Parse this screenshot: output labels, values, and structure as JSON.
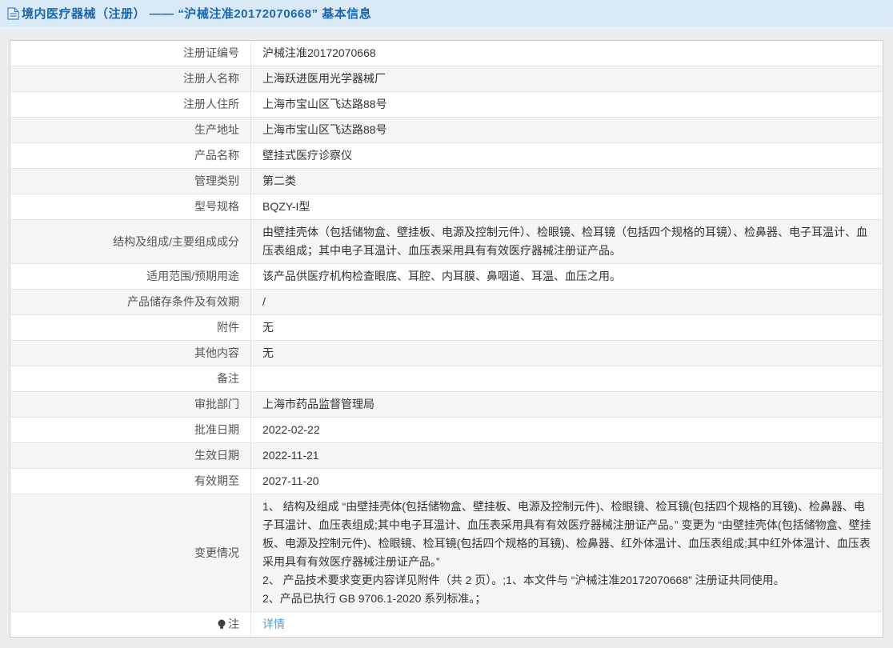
{
  "header": {
    "title": "境内医疗器械（注册） —— “沪械注准20172070668” 基本信息"
  },
  "table": {
    "rows": [
      {
        "label": "注册证编号",
        "value": "沪械注准20172070668"
      },
      {
        "label": "注册人名称",
        "value": "上海跃进医用光学器械厂"
      },
      {
        "label": "注册人住所",
        "value": "上海市宝山区飞达路88号"
      },
      {
        "label": "生产地址",
        "value": "上海市宝山区飞达路88号"
      },
      {
        "label": "产品名称",
        "value": "壁挂式医疗诊察仪"
      },
      {
        "label": "管理类别",
        "value": "第二类"
      },
      {
        "label": "型号规格",
        "value": "BQZY-I型"
      },
      {
        "label": "结构及组成/主要组成成分",
        "value": "由壁挂壳体（包括储物盒、壁挂板、电源及控制元件）、检眼镜、检耳镜（包括四个规格的耳镜）、检鼻器、电子耳温计、血压表组成；其中电子耳温计、血压表采用具有有效医疗器械注册证产品。"
      },
      {
        "label": "适用范围/预期用途",
        "value": "该产品供医疗机构检查眼底、耳腔、内耳膜、鼻咽道、耳温、血压之用。"
      },
      {
        "label": "产品储存条件及有效期",
        "value": "/"
      },
      {
        "label": "附件",
        "value": "无"
      },
      {
        "label": "其他内容",
        "value": "无"
      },
      {
        "label": "备注",
        "value": ""
      },
      {
        "label": "审批部门",
        "value": "上海市药品监督管理局"
      },
      {
        "label": "批准日期",
        "value": "2022-02-22"
      },
      {
        "label": "生效日期",
        "value": "2022-11-21"
      },
      {
        "label": "有效期至",
        "value": "2027-11-20"
      },
      {
        "label": "变更情况",
        "value": "1、 结构及组成 “由壁挂壳体(包括储物盒、壁挂板、电源及控制元件)、检眼镜、检耳镜(包括四个规格的耳镜)、检鼻器、电子耳温计、血压表组成;其中电子耳温计、血压表采用具有有效医疗器械注册证产品。” 变更为 “由壁挂壳体(包括储物盒、壁挂板、电源及控制元件)、检眼镜、检耳镜(包括四个规格的耳镜)、检鼻器、红外体温计、血压表组成;其中红外体温计、血压表采用具有有效医疗器械注册证产品。”\n2、 产品技术要求变更内容详见附件（共 2 页）。;1、本文件与 “沪械注准20172070668” 注册证共同使用。\n2、产品已执行 GB 9706.1-2020 系列标准。；"
      },
      {
        "label": "注",
        "value_link": "详情"
      }
    ]
  },
  "colors": {
    "header_bg": "#d9e9f6",
    "header_text": "#1a67ad",
    "link": "#54a0d9",
    "row_alt_bg": "#f5f5f5"
  }
}
